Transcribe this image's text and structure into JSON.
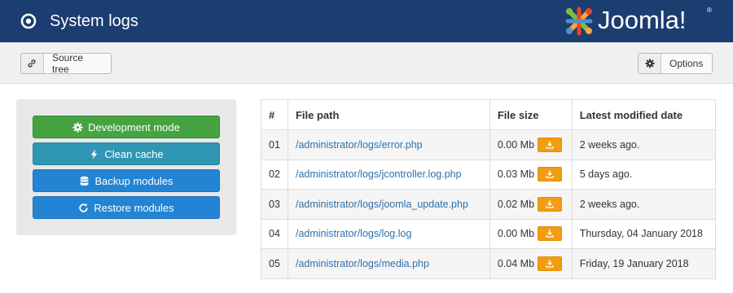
{
  "header": {
    "title": "System logs",
    "page_icon": "target-icon",
    "brand": "Joomla!"
  },
  "toolbar": {
    "source_tree_label": "Source tree",
    "source_tree_icon": "link-icon",
    "options_label": "Options",
    "options_icon": "gear-icon"
  },
  "actions": {
    "development_mode": "Development mode",
    "clean_cache": "Clean cache",
    "backup_modules": "Backup modules",
    "restore_modules": "Restore modules"
  },
  "colors": {
    "header_bg": "#1c3d6f",
    "success": "#45a341",
    "info": "#2f96b4",
    "primary": "#2384d3",
    "warning": "#f39c12",
    "link": "#3071a9"
  },
  "table": {
    "headers": [
      "#",
      "File path",
      "File size",
      "Latest modified date"
    ],
    "rows": [
      {
        "num": "01",
        "path": "/administrator/logs/error.php",
        "size": "0.00 Mb",
        "date": "2 weeks ago."
      },
      {
        "num": "02",
        "path": "/administrator/logs/jcontroller.log.php",
        "size": "0.03 Mb",
        "date": "5 days ago."
      },
      {
        "num": "03",
        "path": "/administrator/logs/joomla_update.php",
        "size": "0.02 Mb",
        "date": "2 weeks ago."
      },
      {
        "num": "04",
        "path": "/administrator/logs/log.log",
        "size": "0.00 Mb",
        "date": "Thursday, 04 January 2018"
      },
      {
        "num": "05",
        "path": "/administrator/logs/media.php",
        "size": "0.04 Mb",
        "date": "Friday, 19 January 2018"
      }
    ]
  }
}
